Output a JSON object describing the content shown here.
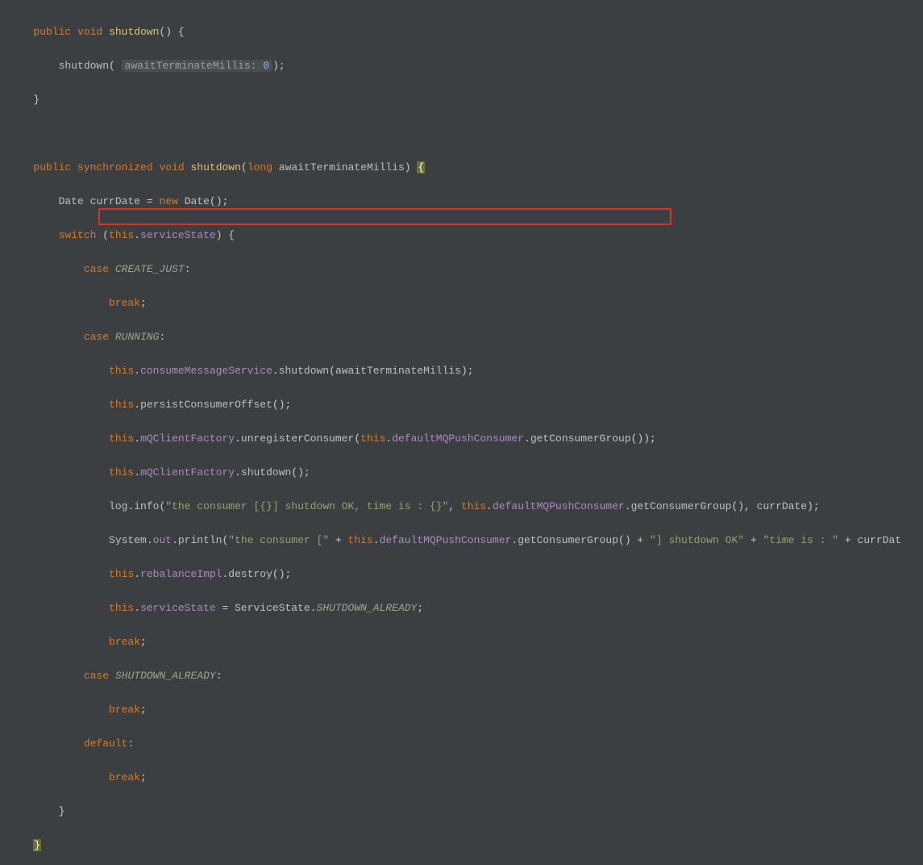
{
  "code": {
    "l1": {
      "kw1": "public",
      "kw2": "void",
      "name": "shutdown",
      "paren": "()",
      "brace": " {"
    },
    "l2": {
      "call": "shutdown",
      "hint_label": "awaitTerminateMillis:",
      "hint_val": "0",
      "tail": ");"
    },
    "l3": {
      "brace": "}"
    },
    "l5": {
      "kw1": "public",
      "kw2": "synchronized",
      "kw3": "void",
      "name": "shutdown",
      "p_open": "(",
      "ptype": "long",
      "pname": "awaitTerminateMillis",
      "p_close": ")",
      "brace": " {"
    },
    "l6": {
      "type": "Date",
      "var": "currDate",
      "eq": " = ",
      "kw_new": "new",
      "ctor": "Date",
      "tail": "();"
    },
    "l7": {
      "kw": "switch",
      "open": " (",
      "this": "this",
      "dot": ".",
      "field": "serviceState",
      "close": ") {"
    },
    "l8": {
      "kw": "case",
      "val": "CREATE_JUST",
      "colon": ":"
    },
    "l9": {
      "kw": "break",
      "semi": ";"
    },
    "l10": {
      "kw": "case",
      "val": "RUNNING",
      "colon": ":"
    },
    "l11": {
      "this": "this",
      "f1": "consumeMessageService",
      "m": "shutdown",
      "arg": "awaitTerminateMillis",
      "tail": ";"
    },
    "l12": {
      "this": "this",
      "m": "persistConsumerOffset",
      "tail": "();"
    },
    "l13": {
      "this1": "this",
      "f1": "mQClientFactory",
      "m": "unregisterConsumer",
      "this2": "this",
      "f2": "defaultMQPushConsumer",
      "m2": "getConsumerGroup",
      "tail": "());"
    },
    "l14": {
      "this": "this",
      "f1": "mQClientFactory",
      "m": "shutdown",
      "tail": "();"
    },
    "l15": {
      "obj": "log",
      "m": "info",
      "str": "\"the consumer [{}] shutdown OK, time is : {}\"",
      "this": "this",
      "f": "defaultMQPushConsumer",
      "m2": "getConsumerGroup",
      "arg2": "currDate",
      "tail": ");"
    },
    "l16": {
      "cls": "System",
      "fld": "out",
      "m": "println",
      "str1": "\"the consumer [\"",
      "this": "this",
      "f": "defaultMQPushConsumer",
      "m2": "getConsumerGroup",
      "str2": "\"] shutdown OK\"",
      "str3": "\"time is : \"",
      "tail": "currDat"
    },
    "l17": {
      "this": "this",
      "f": "rebalanceImpl",
      "m": "destroy",
      "tail": "();"
    },
    "l18": {
      "this": "this",
      "f": "serviceState",
      "eq": " = ",
      "cls": "ServiceState",
      "val": "SHUTDOWN_ALREADY",
      "semi": ";"
    },
    "l19": {
      "kw": "break",
      "semi": ";"
    },
    "l20": {
      "kw": "case",
      "val": "SHUTDOWN_ALREADY",
      "colon": ":"
    },
    "l21": {
      "kw": "break",
      "semi": ";"
    },
    "l22": {
      "kw": "default",
      "colon": ":"
    },
    "l23": {
      "kw": "break",
      "semi": ";"
    },
    "l24": {
      "brace": "}"
    },
    "l25": {
      "brace": "}"
    }
  }
}
